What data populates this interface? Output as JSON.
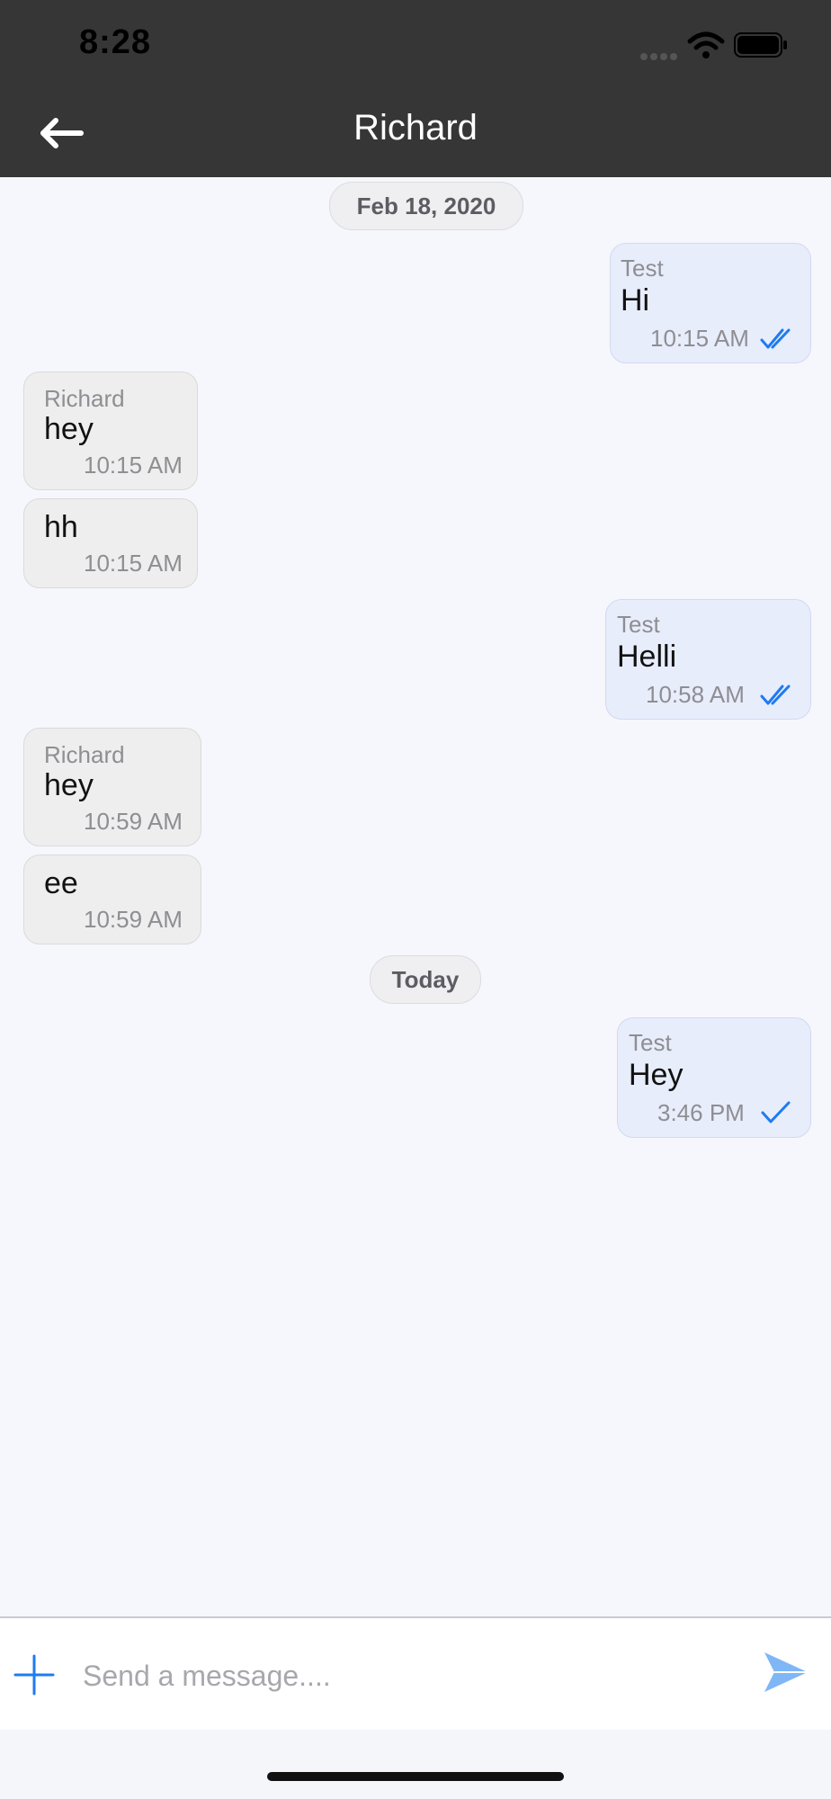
{
  "status_bar": {
    "time": "8:28",
    "icons": [
      "cellular-signal-icon",
      "wifi-icon",
      "battery-icon"
    ]
  },
  "header": {
    "title": "Richard",
    "back_icon": "arrow-left-icon"
  },
  "colors": {
    "header_bg": "#363636",
    "chat_bg": "#f6f7fc",
    "outgoing_bubble": "#e8edfb",
    "incoming_bubble": "#eeeeee",
    "accent": "#1e7bf1"
  },
  "messages": [
    {
      "type": "date",
      "label": "Feb 18, 2020"
    },
    {
      "type": "outgoing",
      "sender": "Test",
      "text": "Hi",
      "time": "10:15 AM",
      "status": "double-check-icon"
    },
    {
      "type": "incoming",
      "sender": "Richard",
      "text": "hey",
      "time": "10:15 AM"
    },
    {
      "type": "incoming",
      "text": "hh",
      "time": "10:15 AM"
    },
    {
      "type": "outgoing",
      "sender": "Test",
      "text": "Helli",
      "time": "10:58 AM",
      "status": "double-check-icon"
    },
    {
      "type": "incoming",
      "sender": "Richard",
      "text": "hey",
      "time": "10:59 AM"
    },
    {
      "type": "incoming",
      "text": "ee",
      "time": "10:59 AM"
    },
    {
      "type": "date",
      "label": "Today"
    },
    {
      "type": "outgoing",
      "sender": "Test",
      "text": "Hey",
      "time": "3:46 PM",
      "status": "check-icon"
    }
  ],
  "composer": {
    "placeholder": "Send a message....",
    "value": "",
    "add_icon": "plus-icon",
    "send_icon": "send-icon"
  }
}
